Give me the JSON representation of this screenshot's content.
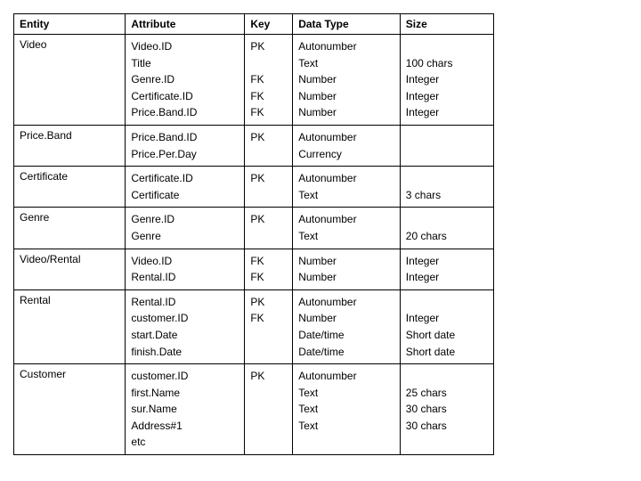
{
  "headers": {
    "entity": "Entity",
    "attribute": "Attribute",
    "key": "Key",
    "datatype": "Data Type",
    "size": "Size"
  },
  "rows": [
    {
      "entity": "Video",
      "attributes": [
        "Video.ID",
        "Title",
        "Genre.ID",
        "Certificate.ID",
        "Price.Band.ID"
      ],
      "keys": [
        "PK",
        "",
        "FK",
        "FK",
        "FK"
      ],
      "datatypes": [
        "Autonumber",
        "Text",
        "Number",
        "Number",
        "Number"
      ],
      "sizes": [
        "",
        "100 chars",
        "Integer",
        "Integer",
        "Integer"
      ]
    },
    {
      "entity": "Price.Band",
      "attributes": [
        "Price.Band.ID",
        "Price.Per.Day"
      ],
      "keys": [
        "PK",
        ""
      ],
      "datatypes": [
        "Autonumber",
        "Currency"
      ],
      "sizes": [
        "",
        ""
      ]
    },
    {
      "entity": "Certificate",
      "attributes": [
        "Certificate.ID",
        "Certificate"
      ],
      "keys": [
        "PK",
        ""
      ],
      "datatypes": [
        "Autonumber",
        "Text"
      ],
      "sizes": [
        "",
        "3 chars"
      ]
    },
    {
      "entity": "Genre",
      "attributes": [
        "Genre.ID",
        "Genre"
      ],
      "keys": [
        "PK",
        ""
      ],
      "datatypes": [
        "Autonumber",
        "Text"
      ],
      "sizes": [
        "",
        "20 chars"
      ]
    },
    {
      "entity": "Video/Rental",
      "attributes": [
        "Video.ID",
        "Rental.ID"
      ],
      "keys": [
        "FK",
        "FK"
      ],
      "datatypes": [
        "Number",
        "Number"
      ],
      "sizes": [
        "Integer",
        "Integer"
      ]
    },
    {
      "entity": "Rental",
      "attributes": [
        "Rental.ID",
        "customer.ID",
        "start.Date",
        "finish.Date"
      ],
      "keys": [
        "PK",
        "FK",
        "",
        ""
      ],
      "datatypes": [
        "Autonumber",
        "Number",
        "Date/time",
        "Date/time"
      ],
      "sizes": [
        "",
        "Integer",
        "Short date",
        "Short date"
      ]
    },
    {
      "entity": "Customer",
      "attributes": [
        "customer.ID",
        "first.Name",
        "sur.Name",
        "Address#1",
        "etc"
      ],
      "keys": [
        "PK",
        "",
        "",
        "",
        ""
      ],
      "datatypes": [
        "Autonumber",
        "Text",
        "Text",
        "Text",
        ""
      ],
      "sizes": [
        "",
        "25 chars",
        "30 chars",
        "30 chars",
        ""
      ]
    }
  ]
}
